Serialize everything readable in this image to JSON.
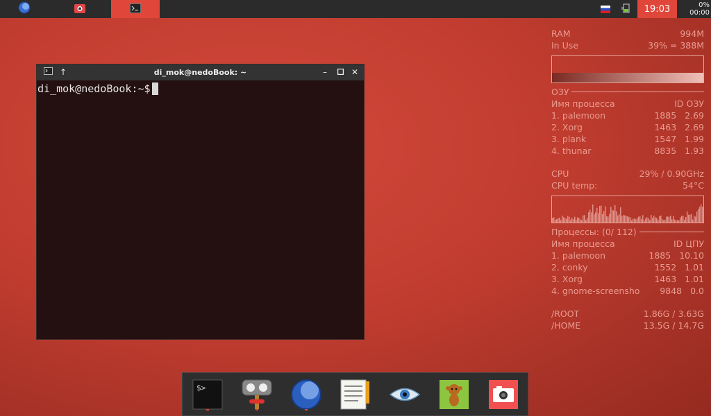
{
  "panel": {
    "clock": "19:03",
    "battery_percent": "0%",
    "battery_time": "00:00",
    "tasks": [
      {
        "icon": "palemoon-icon",
        "active": false
      },
      {
        "icon": "screenshot-app-icon",
        "active": false
      },
      {
        "icon": "terminal-icon",
        "active": true
      }
    ],
    "tray": [
      "russian-flag-icon",
      "battery-icon"
    ]
  },
  "terminal": {
    "title": "di_mok@nedoBook: ~",
    "prompt": "di_mok@nedoBook:~$"
  },
  "conky": {
    "ram_label": "RAM",
    "ram_total": "994M",
    "inuse_label": "In Use",
    "inuse_value": "39% = 388M",
    "mem_section": "ОЗУ",
    "mem_header_name": "Имя процесса",
    "mem_header_cols": "ID ОЗУ",
    "mem_procs": [
      {
        "name": "1. palemoon",
        "id": "1885",
        "val": "2.69"
      },
      {
        "name": "2. Xorg",
        "id": "1463",
        "val": "2.69"
      },
      {
        "name": "3. plank",
        "id": "1547",
        "val": "1.99"
      },
      {
        "name": "4. thunar",
        "id": "8835",
        "val": "1.93"
      }
    ],
    "cpu_label": "CPU",
    "cpu_value": "29% / 0.90GHz",
    "cputemp_label": "CPU temp:",
    "cputemp_value": "54°C",
    "proc_section": "Процессы: (0/ 112)",
    "cpu_header_name": "Имя процесса",
    "cpu_header_cols": "ID ЦПУ",
    "cpu_procs": [
      {
        "name": "1. palemoon",
        "id": "1885",
        "val": "10.10"
      },
      {
        "name": "2. conky",
        "id": "1552",
        "val": "1.01"
      },
      {
        "name": "3. Xorg",
        "id": "1463",
        "val": "1.01"
      },
      {
        "name": "4. gnome-screensho",
        "id": "9848",
        "val": "0.0"
      }
    ],
    "root_label": "/ROOT",
    "root_value": "1.86G / 3.63G",
    "home_label": "/HOME",
    "home_value": "13.5G / 14.7G"
  },
  "dock": [
    "terminal-icon",
    "system-tools-icon",
    "palemoon-icon",
    "text-editor-icon",
    "viewer-eye-icon",
    "monkey-app-icon",
    "screenshot-camera-icon"
  ]
}
